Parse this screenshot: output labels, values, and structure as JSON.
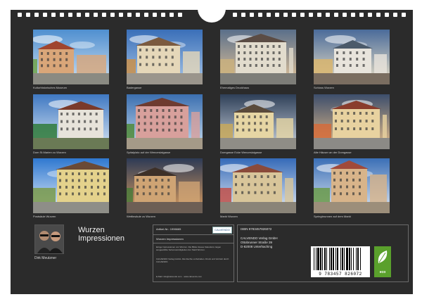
{
  "photos": [
    {
      "caption": "Kulturhistorisches Museum",
      "palette": "p1"
    },
    {
      "caption": "Badergasse",
      "palette": "p2"
    },
    {
      "caption": "Ehemaliges Druckhaus",
      "palette": "p3"
    },
    {
      "caption": "Schloss Wurzen",
      "palette": "p4"
    },
    {
      "caption": "Dom St.Marien zu Wurzen",
      "palette": "p5"
    },
    {
      "caption": "Spitalplatz auf der Wenceslaigasse",
      "palette": "p6"
    },
    {
      "caption": "Domgasse Ecke Wenceslaigasse",
      "palette": "p7"
    },
    {
      "caption": "Alte Häuser an der Domgasse",
      "palette": "p8"
    },
    {
      "caption": "Postsäule Wurzen",
      "palette": "p9"
    },
    {
      "caption": "Wettinsäule zu Wurzen",
      "palette": "p10"
    },
    {
      "caption": "Markt Wurzen",
      "palette": "p11"
    },
    {
      "caption": "Springbrunnen auf dem Markt",
      "palette": "p12"
    }
  ],
  "author": {
    "name": "Dirk Meutzner"
  },
  "calendar_title": {
    "line1": "Wurzen",
    "line2": "Impressionen"
  },
  "info": {
    "article_no": "Artikel-Nr.: 1996665",
    "brand": "CALVENDO",
    "isbn": "ISBN 9783457826072",
    "subtitle": "Wurzen Impressionen",
    "text1": "Einige Impressionen von Wurzen. Die Bilder dieses Kalenders zeigen ausgewählte Sehenswürdigkeiten der Stadt Wurzen.",
    "text2": "CALVENDO Verlag GmbH. Alle Rechte vorbehalten. Druck und Vertrieb durch CALVENDO.",
    "email": "E-Mail: info@calvendo.com · www.calvendo.com"
  },
  "publisher": {
    "name": "CALVENDO Verlag GmbH",
    "street": "Ottobrunner Straße 39",
    "city": "D-82008 Unterhaching"
  },
  "barcode_number": "9 783457 826072",
  "eco_label": "eco"
}
